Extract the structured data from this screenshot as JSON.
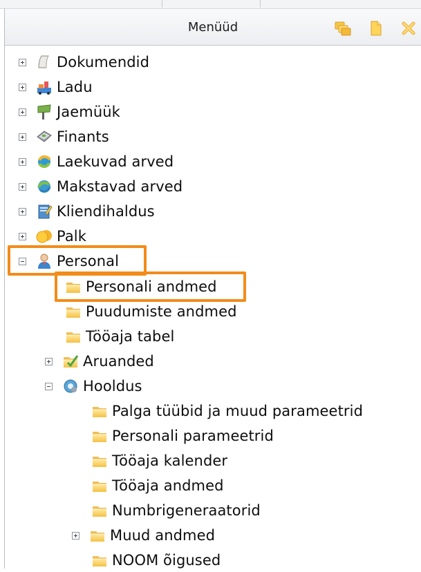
{
  "header": {
    "title": "Menüüd"
  },
  "header_buttons": [
    "folders-icon",
    "folder-icon",
    "close-icon"
  ],
  "tree": {
    "top_items": [
      {
        "label": "Dokumendid",
        "icon": "document-icon"
      },
      {
        "label": "Ladu",
        "icon": "warehouse-icon"
      },
      {
        "label": "Jaemüük",
        "icon": "sign-icon"
      },
      {
        "label": "Finants",
        "icon": "finance-icon"
      },
      {
        "label": "Laekuvad arved",
        "icon": "receivable-icon"
      },
      {
        "label": "Makstavad arved",
        "icon": "payable-icon"
      },
      {
        "label": "Kliendihaldus",
        "icon": "customer-icon"
      },
      {
        "label": "Palk",
        "icon": "salary-icon"
      }
    ],
    "personal": {
      "label": "Personal",
      "icon": "person-icon",
      "children": [
        {
          "label": "Personali andmed"
        },
        {
          "label": "Puudumiste andmed"
        },
        {
          "label": "Tööaja tabel"
        }
      ],
      "aruanded": {
        "label": "Aruanded"
      },
      "hooldus": {
        "label": "Hooldus",
        "children": [
          {
            "label": "Palga tüübid ja muud parameetrid"
          },
          {
            "label": "Personali parameetrid"
          },
          {
            "label": "Tööaja kalender"
          },
          {
            "label": "Tööaja andmed"
          },
          {
            "label": "Numbrigeneraatorid"
          },
          {
            "label": "Muud andmed"
          },
          {
            "label": "NOOM õigused"
          }
        ]
      }
    }
  },
  "highlight_color": "#f28c1a"
}
